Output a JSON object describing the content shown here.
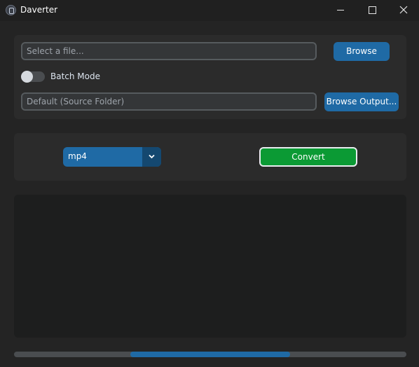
{
  "window": {
    "title": "Daverter"
  },
  "input": {
    "file_placeholder": "Select a file...",
    "browse_label": "Browse"
  },
  "batch": {
    "label": "Batch Mode",
    "enabled": false
  },
  "output": {
    "placeholder": "Default (Source Folder)",
    "browse_label": "Browse Output..."
  },
  "format": {
    "selected": "mp4"
  },
  "convert": {
    "label": "Convert"
  },
  "progress": {
    "indeterminate": true
  },
  "colors": {
    "accent": "#1f6aa5",
    "convert_green": "#0b9a34",
    "background": "#242424",
    "panel": "#2b2b2b"
  }
}
